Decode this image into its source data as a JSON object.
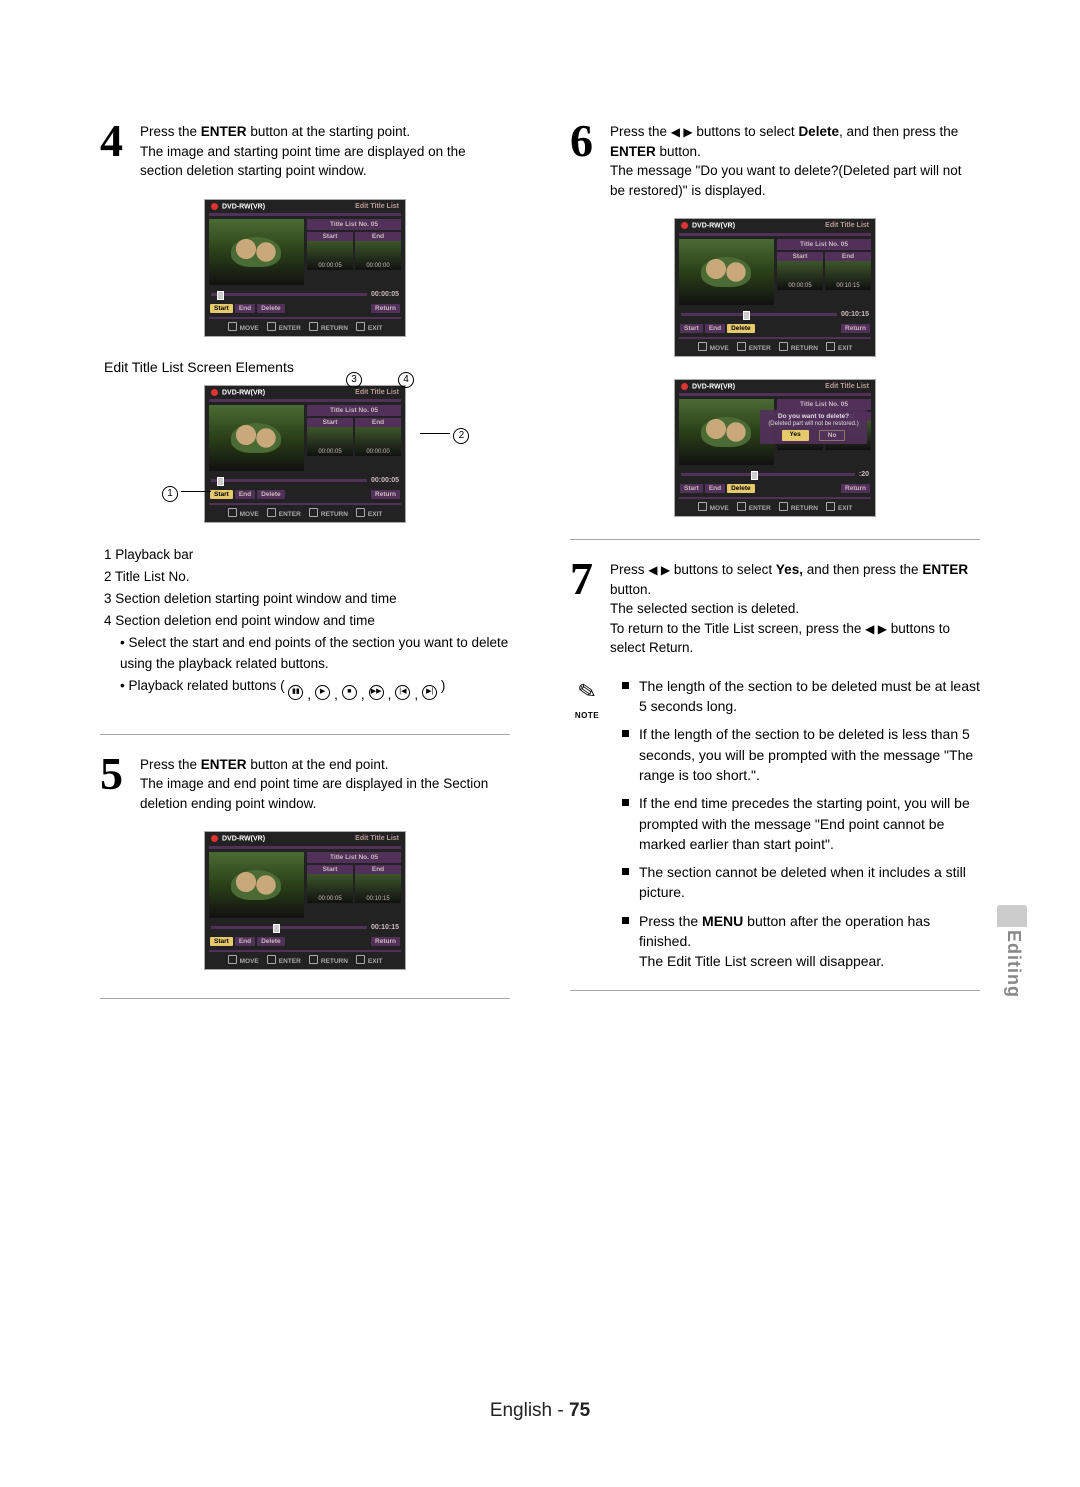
{
  "steps": {
    "s4": {
      "num": "4",
      "text_plain": "Press the",
      "bold1": "ENTER",
      "text2": "button at the starting point.",
      "text3": "The image and starting point time are displayed on the section deletion starting point window."
    },
    "s5": {
      "num": "5",
      "text_plain": "Press the",
      "bold1": "ENTER",
      "text2": "button at the end point.",
      "text3": "The image and end point time are displayed in the Section deletion ending point window."
    },
    "s6": {
      "num": "6",
      "text_plain": "Press the",
      "arrows": "◀ ▶",
      "text2": "buttons to select",
      "bold1": "Delete",
      "text3": ", and then press the",
      "bold2": "ENTER",
      "text4": "button.",
      "text5": "The message \"Do you want to delete?(Deleted part will not be restored)\" is displayed."
    },
    "s7": {
      "num": "7",
      "text_plain": "Press",
      "arrows": "◀ ▶",
      "text2": "buttons to select",
      "bold1": "Yes,",
      "text3": "and then press the",
      "bold2": "ENTER",
      "text4": "button.",
      "text5": "The selected section is deleted.",
      "text6": "To return to the Title List screen, press the",
      "arrows2": "◀ ▶",
      "text7": "buttons to select Return."
    }
  },
  "screens": {
    "common": {
      "disc": "DVD-RW(VR)",
      "header": "Edit Title List",
      "titleListNo": "Title List No. 05",
      "startLbl": "Start",
      "endLbl": "End",
      "btnStart": "Start",
      "btnEnd": "End",
      "btnDelete": "Delete",
      "btnReturn": "Return",
      "footMove": "MOVE",
      "footEnter": "ENTER",
      "footReturn": "RETURN",
      "footExit": "EXIT"
    },
    "screenA": {
      "startTs": "00:00:05",
      "endTs": "00:00:00",
      "progTime": "00:00:05",
      "knobPct": 4
    },
    "screenB": {
      "startTs": "00:00:05",
      "endTs": "00:10:15",
      "progTime": "00:10:15",
      "knobPct": 40
    },
    "screenC": {
      "startTs": "00:00:05",
      "endTs": "00:10:15",
      "progTime": "00:10:15",
      "knobPct": 40
    },
    "screenD": {
      "q1": "Do you want to delete?",
      "q2": "(Deleted part will not be restored.)",
      "yes": "Yes",
      "no": "No",
      "progTimeLeft": "-",
      "progTimeRight": ":20",
      "knobPct": 40
    },
    "screenE": {
      "startTs": "00:00:05",
      "endTs": "00:00:00",
      "progTime": "00:00:05",
      "knobPct": 4
    }
  },
  "elementsCaption": "Edit Title List Screen Elements",
  "callouts": {
    "c1": "1",
    "c2": "2",
    "c3": "3",
    "c4": "4"
  },
  "elementsList": {
    "i1": "1 Playback bar",
    "i2": "2 Title List No.",
    "i3": "3 Section deletion starting point window and time",
    "i4": "4 Section deletion end point window and time",
    "sub1": "Select the start and end points of the section you want to delete using the playback related buttons.",
    "sub2": "Playback related buttons ("
  },
  "notes": {
    "label": "NOTE",
    "n1": "The length of the section to be deleted must be at least 5 seconds long.",
    "n2": "If the length of the section to be deleted is less than 5 seconds, you will be prompted with the message \"The range is too short.\".",
    "n3": "If the end time precedes the starting point, you will be prompted with the message \"End point cannot be marked earlier than start point\".",
    "n4": "The section cannot be deleted when it includes a still picture.",
    "n5a": "Press the",
    "n5bold": "MENU",
    "n5b": "button after the operation has finished.",
    "n5c": "The Edit Title List screen will disappear."
  },
  "sideTab": "Editing",
  "footer": {
    "lang": "English",
    "dash": "-",
    "page": "75"
  }
}
